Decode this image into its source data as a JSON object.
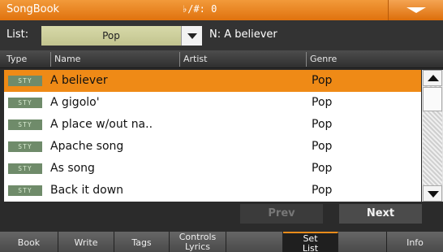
{
  "titlebar": {
    "app": "SongBook",
    "key": "♭/#: 0"
  },
  "list": {
    "label": "List:",
    "value": "Pop",
    "n_label": "N: A believer"
  },
  "columns": {
    "type": "Type",
    "name": "Name",
    "artist": "Artist",
    "genre": "Genre"
  },
  "rows": [
    {
      "type": "STY",
      "name": "A believer",
      "genre": "Pop"
    },
    {
      "type": "STY",
      "name": "A gigolo'",
      "genre": "Pop"
    },
    {
      "type": "STY",
      "name": "A place w/out na..",
      "genre": "Pop"
    },
    {
      "type": "STY",
      "name": "Apache song",
      "genre": "Pop"
    },
    {
      "type": "STY",
      "name": "As song",
      "genre": "Pop"
    },
    {
      "type": "STY",
      "name": "Back it down",
      "genre": "Pop"
    }
  ],
  "buttons": {
    "prev": "Prev",
    "next": "Next"
  },
  "tabs": {
    "book": "Book",
    "write": "Write",
    "tags": "Tags",
    "controls_line1": "Controls",
    "controls_line2": "Lyrics",
    "setlist_line1": "Set",
    "setlist_line2": "List",
    "info": "Info"
  },
  "icons": {
    "menu": "chevron-down-icon",
    "combo": "dropdown-arrow-icon",
    "scroll_up": "scroll-up-icon",
    "scroll_down": "scroll-down-icon"
  },
  "colors": {
    "accent": "#e0720e",
    "selected_row": "#ef8a16",
    "style_badge": "#6f8b6a"
  }
}
